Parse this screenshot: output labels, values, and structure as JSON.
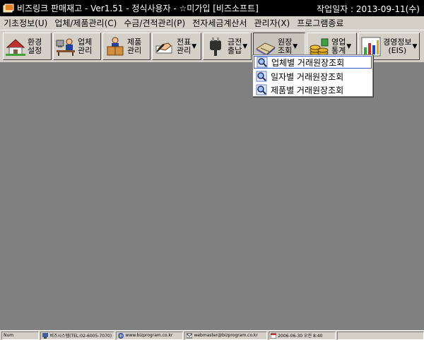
{
  "window": {
    "title": "비즈링크 판매재고 - Ver1.51 - 정식사용자 - ☆미가입 [비즈소프트]",
    "date_label": "작업일자 : 2013-09-11(수)"
  },
  "menubar": {
    "items": [
      "기초정보(U)",
      "업체/제품관리(C)",
      "수금/견적관리(P)",
      "전자세금계산서",
      "관리자(X)",
      "프로그램종료"
    ]
  },
  "toolbar": {
    "buttons": [
      {
        "label": "환경\n설정",
        "icon": "house-icon"
      },
      {
        "label": "업체\n관리",
        "icon": "office-worker-icon"
      },
      {
        "label": "제품\n관리",
        "icon": "boxes-icon"
      },
      {
        "label": "전표\n관리",
        "icon": "pen-hand-icon",
        "has_dropdown": true
      },
      {
        "label": "금전\n출납",
        "icon": "plug-icon",
        "has_dropdown": true
      },
      {
        "label": "원장\n조회",
        "icon": "ledger-book-icon",
        "has_dropdown": true,
        "pressed": true
      },
      {
        "label": "영업\n통계",
        "icon": "coins-icon",
        "has_dropdown": true
      },
      {
        "label": "경영정보\n(EIS)",
        "icon": "bar-chart-icon",
        "has_dropdown": true
      }
    ]
  },
  "dropdown": {
    "items": [
      {
        "label": "업체별 거래원장조회",
        "icon": "magnifier-icon",
        "selected": true
      },
      {
        "label": "일자별 거래원장조회",
        "icon": "magnifier-icon"
      },
      {
        "label": "제품별 거래원장조회",
        "icon": "magnifier-icon"
      }
    ]
  },
  "statusbar": {
    "num": "Num",
    "company": "비즈시스템(TEL:02-6005-7070)",
    "website": "www.bizprogram.co.kr",
    "email": "webmaster@bizprogram.co.kr",
    "datetime": "2006-06-30 오전 8:40"
  },
  "colors": {
    "workspace": "#808080",
    "chrome": "#d4d0c8",
    "titlebar": "#000000",
    "selection_border": "#3355cc"
  }
}
